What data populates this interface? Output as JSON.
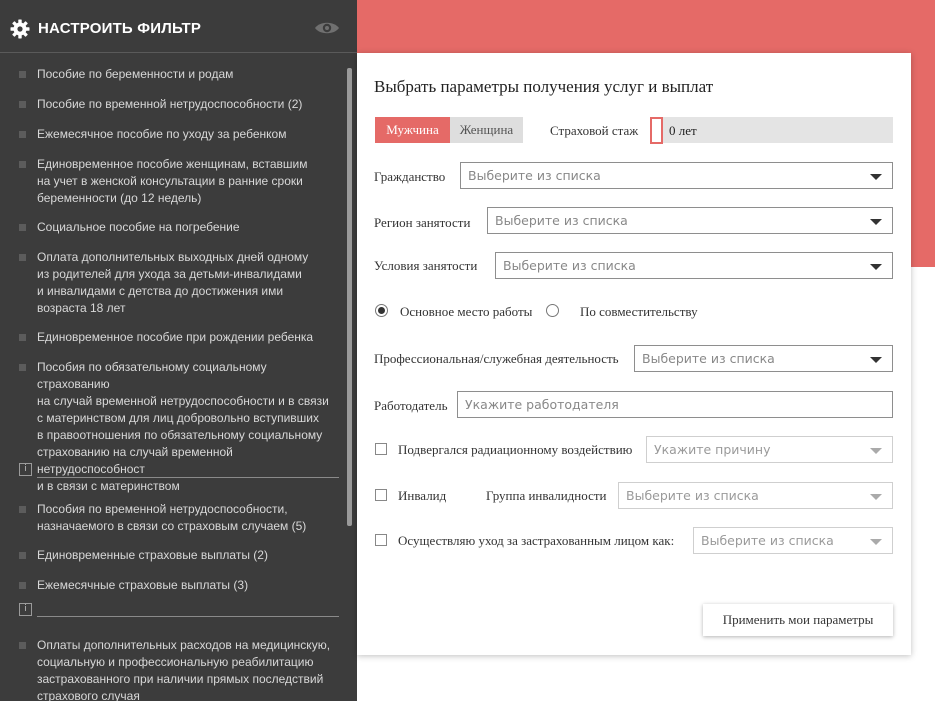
{
  "sidebar": {
    "title": "НАСТРОИТЬ ФИЛЬТР",
    "items": [
      {
        "label": "Пособие по беременности и родам"
      },
      {
        "label": "Пособие по временной нетрудоспособности (2)"
      },
      {
        "label": "Ежемесячное пособие по уходу за ребенком"
      },
      {
        "label": "Единовременное пособие женщинам, вставшим\nна учет в женской консультации в ранние сроки\nбеременности (до 12 недель)"
      },
      {
        "label": "Социальное пособие на погребение"
      },
      {
        "label": "Оплата дополнительных выходных дней одному\nиз родителей для ухода за детьми-инвалидами\nи инвалидами с детства до достижения ими\nвозраста 18 лет"
      },
      {
        "label": "Единовременное пособие при рождении ребенка"
      },
      {
        "label": "Пособия по обязательному социальному страхованию\nна случай временной нетрудоспособности и в связи\nс материнством для лиц добровольно вступивших\nв правоотношения по обязательному социальному\nстрахованию на случай временной нетрудоспособност\nи в связи с материнством"
      },
      {
        "label": "Пособия по временной нетрудоспособности,\nназначаемого в связи со страховым случаем (5)"
      },
      {
        "label": "Единовременные страховые выплаты (2)"
      },
      {
        "label": "Ежемесячные страховые выплаты (3)"
      },
      {
        "label": "Оплаты дополнительных расходов на медицинскую,\nсоциальную и профессиональную реабилитацию\nзастрахованного при наличии прямых последствий\nстрахового случая"
      }
    ],
    "info_glyph": "i"
  },
  "form": {
    "title": "Выбрать параметры получения услуг и выплат",
    "gender": {
      "male": "Мужчина",
      "female": "Женщина",
      "selected": "male"
    },
    "stazh": {
      "label": "Страховой стаж",
      "value": "0 лет"
    },
    "citizenship": {
      "label": "Гражданство",
      "placeholder": "Выберите из списка"
    },
    "region": {
      "label": "Регион занятости",
      "placeholder": "Выберите из списка"
    },
    "conditions": {
      "label": "Условия занятости",
      "placeholder": "Выберите из списка"
    },
    "workplace": {
      "main": "Основное место работы",
      "parttime": "По совместительству",
      "selected": "main"
    },
    "profession": {
      "label": "Профессиональная/служебная деятельность",
      "placeholder": "Выберите из списка"
    },
    "employer": {
      "label": "Работодатель",
      "placeholder": "Укажите работодателя"
    },
    "radiation": {
      "label": "Подвергался радиационному воздействию",
      "placeholder": "Укажите причину"
    },
    "disability": {
      "label": "Инвалид",
      "group_label": "Группа инвалидности",
      "placeholder": "Выберите из списка"
    },
    "care": {
      "label": "Осуществляю уход за застрахованным лицом как:",
      "placeholder": "Выберите из списка"
    },
    "apply_label": "Применить мои параметры"
  },
  "colors": {
    "accent": "#e56a67",
    "sidebar_bg": "#3c3c3c"
  }
}
